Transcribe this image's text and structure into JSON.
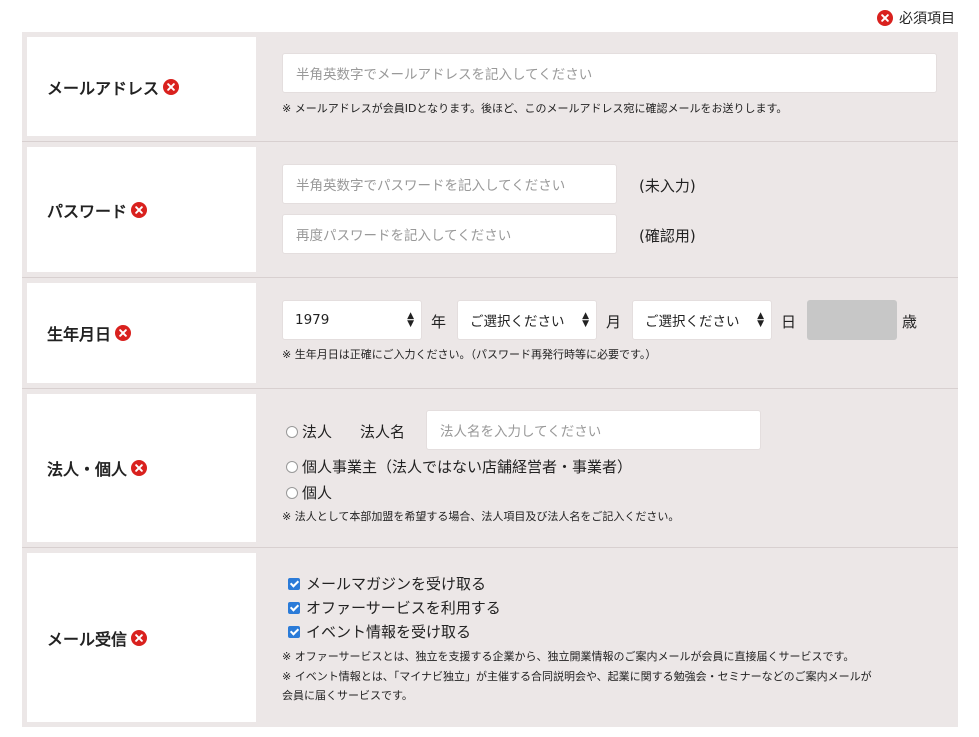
{
  "legend": {
    "label": "必須項目"
  },
  "email": {
    "label": "メールアドレス",
    "placeholder": "半角英数字でメールアドレスを記入してください",
    "note": "※ メールアドレスが会員IDとなります。後ほど、このメールアドレス宛に確認メールをお送りします。"
  },
  "password": {
    "label": "パスワード",
    "placeholder": "半角英数字でパスワードを記入してください",
    "confirm_placeholder": "再度パスワードを記入してください",
    "status": "(未入力)",
    "confirm_status": "(確認用)"
  },
  "birthdate": {
    "label": "生年月日",
    "year_value": "1979",
    "year_unit": "年",
    "month_value": "ご選択ください",
    "month_unit": "月",
    "day_value": "ご選択ください",
    "day_unit": "日",
    "age_unit": "歳",
    "note": "※ 生年月日は正確にご入力ください。（パスワード再発行時等に必要です。）"
  },
  "entity": {
    "label": "法人・個人",
    "option_corp": "法人",
    "corp_name_label": "法人名",
    "corp_name_placeholder": "法人名を入力してください",
    "option_sole": "個人事業主（法人ではない店舗経営者・事業者）",
    "option_individual": "個人",
    "note": "※ 法人として本部加盟を希望する場合、法人項目及び法人名をご記入ください。"
  },
  "mail": {
    "label": "メール受信",
    "option_magazine": "メールマガジンを受け取る",
    "option_offer": "オファーサービスを利用する",
    "option_event": "イベント情報を受け取る",
    "note1": "※ オファーサービスとは、独立を支援する企業から、独立開業情報のご案内メールが会員に直接届くサービスです。",
    "note2_line1": "※ イベント情報とは、「マイナビ独立」が主催する合同説明会や、起業に関する勉強会・セミナーなどのご案内メールが",
    "note2_line2": "会員に届くサービスです。"
  },
  "colors": {
    "required": "#d9211e",
    "panel": "#ece7e7",
    "checkbox": "#2b7bd8"
  }
}
